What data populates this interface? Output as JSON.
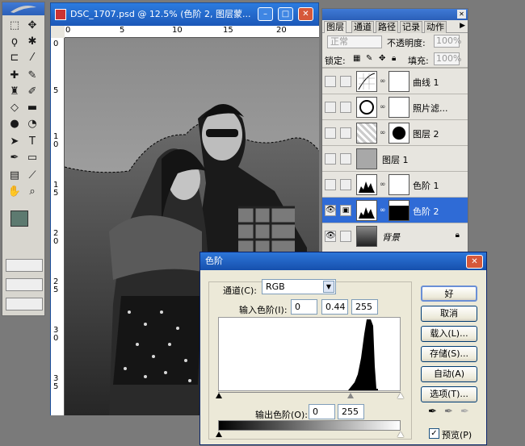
{
  "document": {
    "title": "DSC_1707.psd @ 12.5% (色阶 2, 图层蒙...",
    "ruler_top": [
      "0",
      "5",
      "10",
      "15",
      "20"
    ],
    "ruler_left": [
      "0",
      "5",
      "1\n0",
      "1\n5",
      "2\n0",
      "2\n5",
      "3\n0",
      "3\n5"
    ]
  },
  "tools": {
    "icons": [
      "marquee-icon",
      "move-icon",
      "lasso-icon",
      "magic-wand-icon",
      "crop-icon",
      "slice-icon",
      "healing-brush-icon",
      "brush-icon",
      "clone-stamp-icon",
      "history-brush-icon",
      "eraser-icon",
      "gradient-icon",
      "blur-icon",
      "dodge-icon",
      "path-select-icon",
      "type-icon",
      "pen-icon",
      "shape-icon",
      "notes-icon",
      "eyedropper-icon",
      "hand-icon",
      "zoom-icon"
    ],
    "foreground_color": "#5d7a70",
    "background_color": "#ffffff"
  },
  "layers_panel": {
    "tabs": [
      "图层",
      "通道",
      "路径",
      "记录",
      "动作"
    ],
    "blend_mode": "正常",
    "opacity_label": "不透明度:",
    "opacity_value": "100%",
    "lock_label": "锁定:",
    "fill_label": "填充:",
    "fill_value": "100%",
    "layers": [
      {
        "name": "曲线 1",
        "visible": false,
        "selected": false
      },
      {
        "name": "照片滤...",
        "visible": false,
        "selected": false
      },
      {
        "name": "图层 2",
        "visible": false,
        "selected": false
      },
      {
        "name": "图层 1",
        "visible": false,
        "selected": false
      },
      {
        "name": "色阶 1",
        "visible": false,
        "selected": false
      },
      {
        "name": "色阶 2",
        "visible": true,
        "selected": true
      },
      {
        "name": "背景",
        "visible": true,
        "selected": false
      }
    ]
  },
  "levels_dialog": {
    "title": "色阶",
    "channel_label": "通道(C):",
    "channel_value": "RGB",
    "input_label": "输入色阶(I):",
    "input_values": [
      "0",
      "0.44",
      "255"
    ],
    "output_label": "输出色阶(O):",
    "output_values": [
      "0",
      "255"
    ],
    "buttons": [
      "好",
      "取消",
      "载入(L)...",
      "存储(S)...",
      "自动(A)",
      "选项(T)..."
    ],
    "preview_label": "预览(P)",
    "preview_checked": true
  }
}
